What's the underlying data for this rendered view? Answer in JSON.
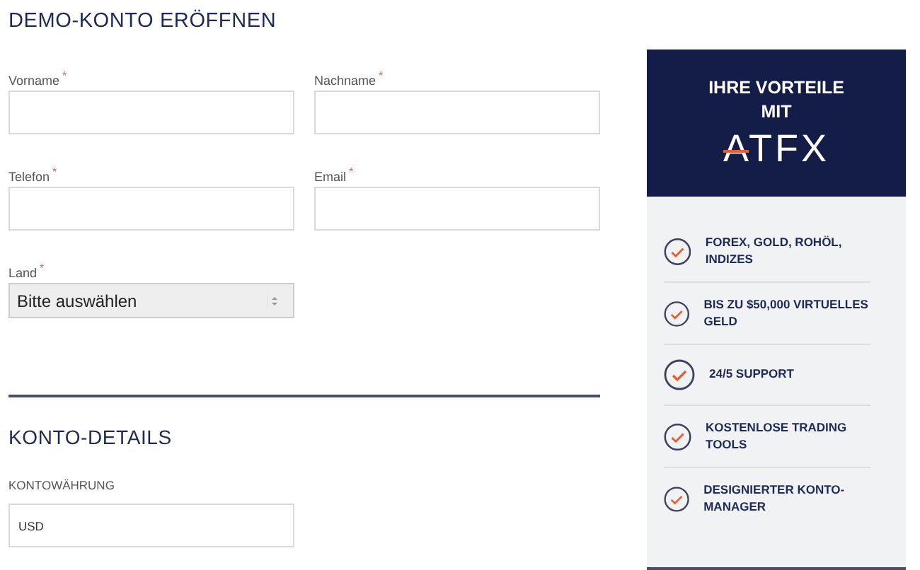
{
  "title": "DEMO-KONTO ERÖFFNEN",
  "fields": [
    {
      "label": "Vorname",
      "asterisk": "*",
      "kind": "input"
    },
    {
      "label": "Nachname",
      "asterisk": "*",
      "kind": "input"
    },
    {
      "label": "Telefon",
      "asterisk": "*",
      "kind": "input"
    },
    {
      "label": "Email",
      "asterisk": "*",
      "kind": "input"
    },
    {
      "label": "Land",
      "asterisk": "*",
      "kind": "select",
      "value": "Bitte auswählen"
    }
  ],
  "details": {
    "title": "KONTO-DETAILS",
    "label": "KONTOWÄHRUNG",
    "value": "USD"
  },
  "sidebar": {
    "heading": "IHRE VORTEILE MIT",
    "logo": "ATFX",
    "benefits": [
      "FOREX, GOLD, ROHÖL, INDIZES",
      "BIS ZU $50,000 VIRTUELLES GELD",
      "24/5 SUPPORT",
      "KOSTENLOSE TRADING TOOLS",
      "DESIGNIERTER KONTO-MANAGER"
    ]
  }
}
